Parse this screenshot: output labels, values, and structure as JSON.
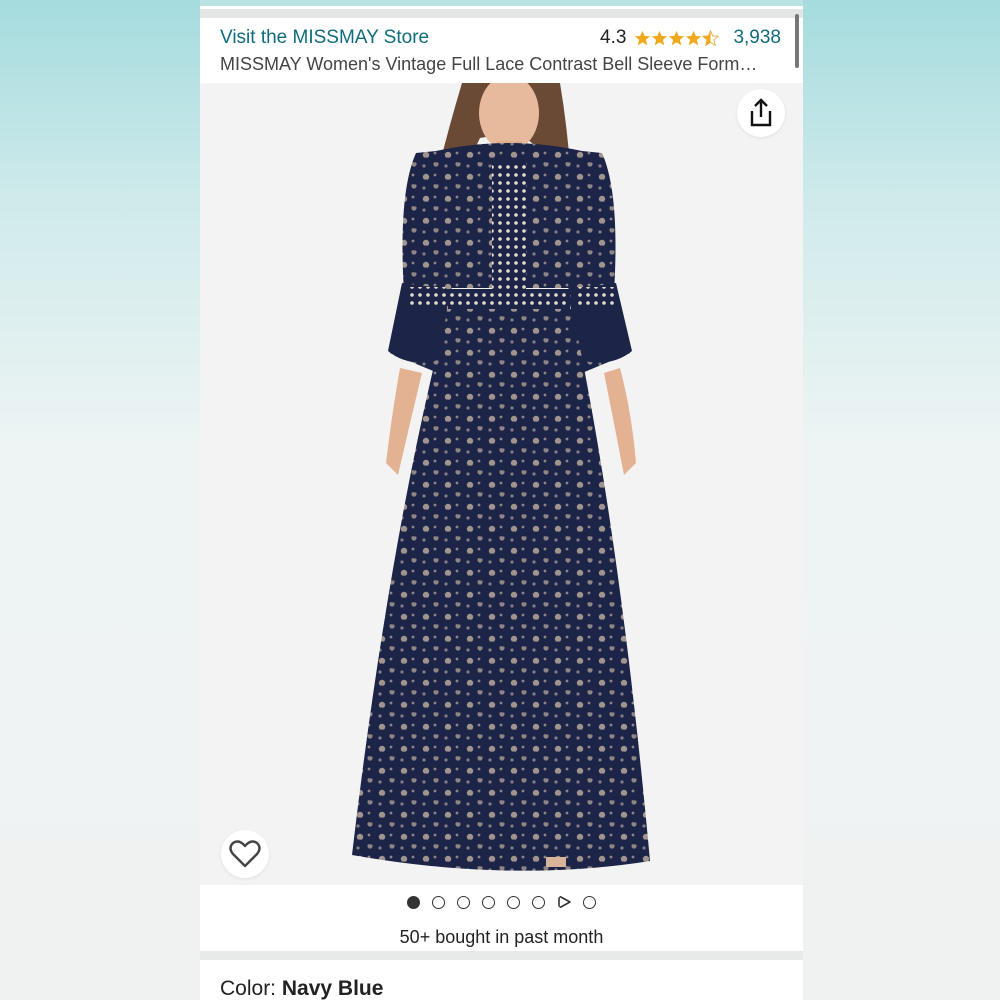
{
  "header": {
    "store_link": "Visit the MISSMAY Store",
    "rating_value": "4.3",
    "rating_stars": 4.3,
    "review_count": "3,938",
    "product_title": "MISSMAY Women's Vintage Full Lace Contrast Bell Sleeve Form…"
  },
  "image_gallery": {
    "image_count": 8,
    "active_index": 0,
    "video_index": 6
  },
  "social_proof": {
    "bought_text": "50+ bought in past month"
  },
  "variant": {
    "color_label": "Color: ",
    "color_value": "Navy Blue"
  },
  "colors": {
    "link": "#0f6c7c",
    "star": "#f0a91b",
    "dress_navy": "#1c2447",
    "lining": "#d9c7b6"
  },
  "icons": {
    "share": "share-icon",
    "wishlist": "heart-icon",
    "star": "star-icon",
    "play": "play-icon"
  }
}
